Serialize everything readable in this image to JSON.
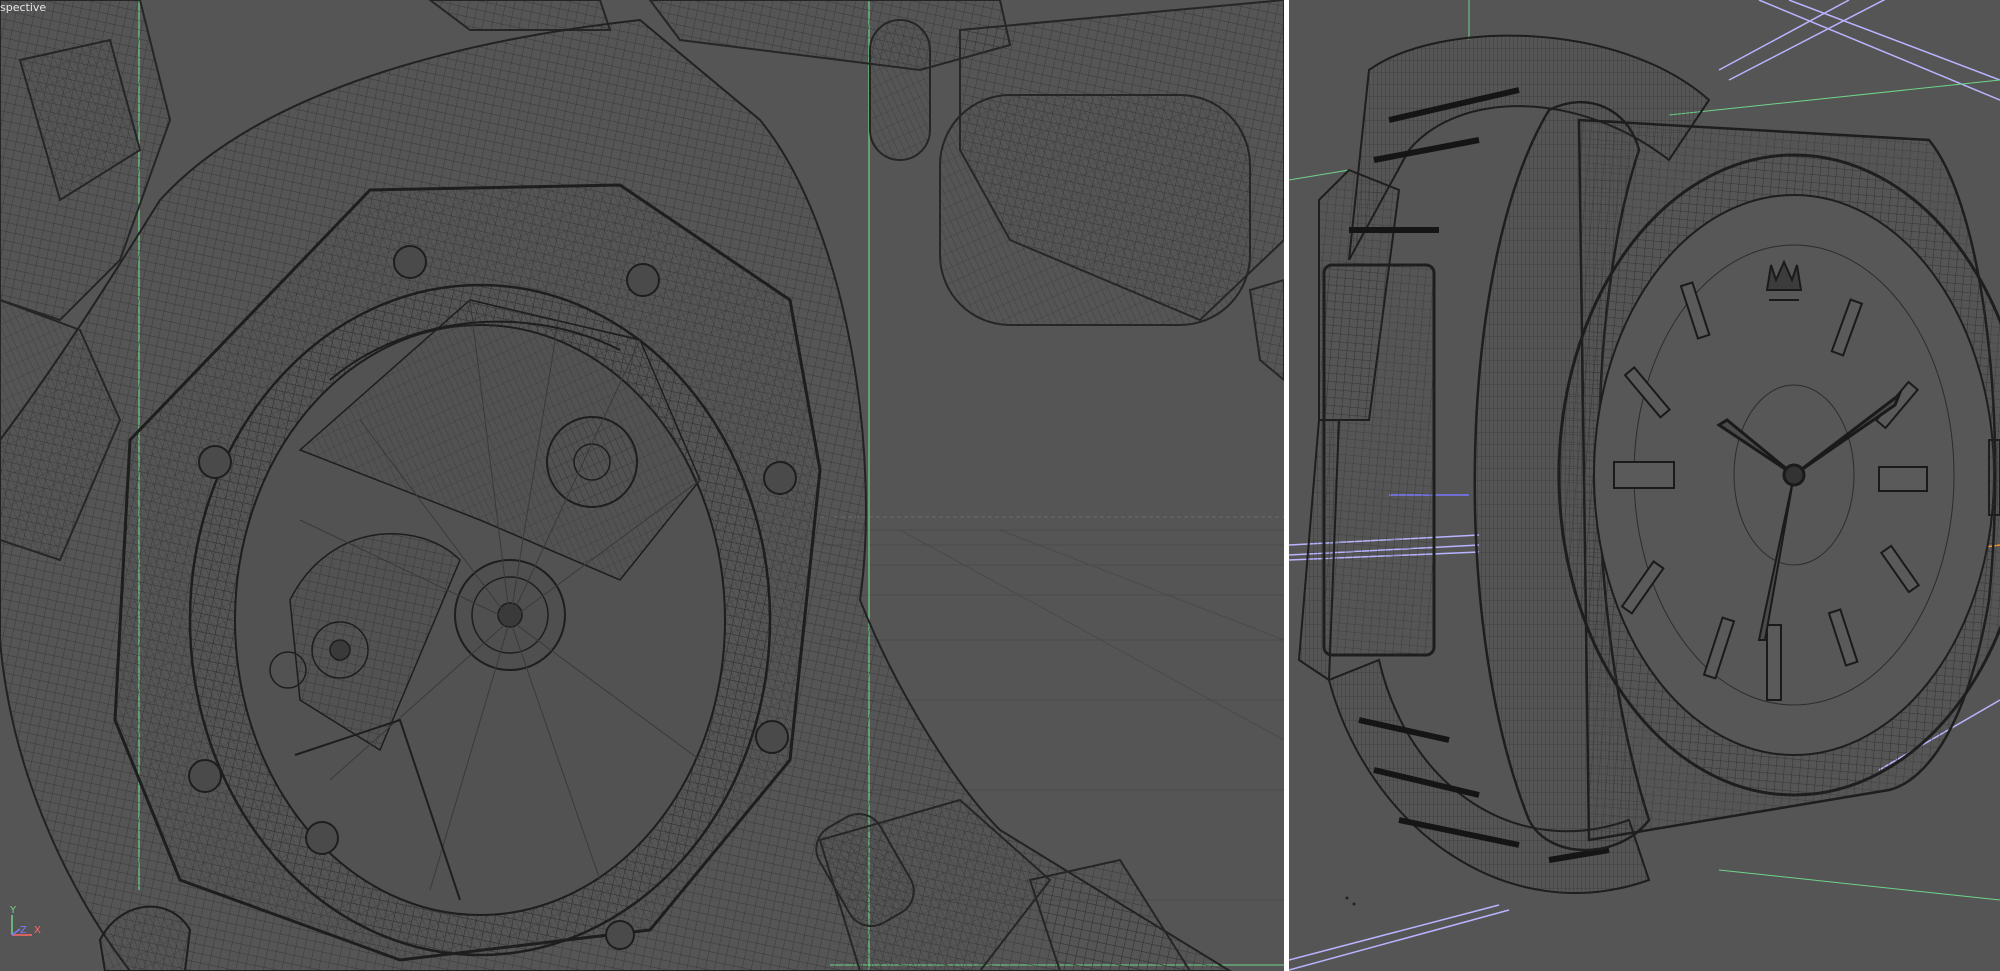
{
  "viewports": {
    "left": {
      "label": "spective",
      "subject": "watch-caseback-wireframe"
    },
    "right": {
      "label": "",
      "subject": "watch-front-wireframe"
    }
  },
  "axis_gizmo": {
    "y_label": "Y",
    "z_label": "Z",
    "x_label": "X"
  },
  "colors": {
    "viewport_bg": "#555555",
    "wire": "#2a2a2a",
    "grid_line": "#6b6b6b",
    "axis_green": "#6fd38a",
    "axis_blue": "#7a7aff",
    "axis_orange": "#ff9a2a",
    "selection_lavender": "#b9b4ff",
    "divider": "#ffffff"
  }
}
